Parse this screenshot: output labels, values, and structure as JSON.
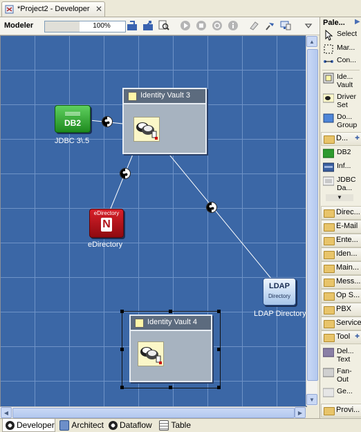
{
  "editor": {
    "tab_title": "*Project2 - Developer",
    "close_symbol": "✕"
  },
  "toolbar": {
    "modeler_label": "Modeler",
    "zoom_value": "100%"
  },
  "palette": {
    "title": "Pale...",
    "items_top": [
      {
        "label": "Select",
        "icon": "arrow-icon"
      },
      {
        "label": "Mar...",
        "icon": "marquee-icon"
      },
      {
        "label": "Con...",
        "icon": "connection-icon"
      },
      {
        "label": "Ide... Vault",
        "icon": "identity-vault-icon"
      },
      {
        "label": "Driver Set",
        "icon": "driver-set-icon"
      },
      {
        "label": "Do... Group",
        "icon": "domain-group-icon"
      }
    ],
    "drawer_open": {
      "label": "D..."
    },
    "items_drawer": [
      {
        "label": "DB2",
        "icon": "db2-icon"
      },
      {
        "label": "Inf...",
        "icon": "informix-icon"
      },
      {
        "label": "JDBC Da...",
        "icon": "jdbc-icon"
      }
    ],
    "drawers": [
      "Direc...",
      "E-Mail",
      "Ente...",
      "Iden...",
      "Main...",
      "Mess...",
      "Op S...",
      "PBX",
      "Service"
    ],
    "tool_drawer": {
      "label": "Tool"
    },
    "tool_items": [
      {
        "label": "Del... Text",
        "icon": "delimited-text-icon"
      },
      {
        "label": "Fan-Out",
        "icon": "fan-out-icon"
      },
      {
        "label": "Ge...",
        "icon": "generic-icon"
      }
    ],
    "last_drawer": "Provi..."
  },
  "canvas": {
    "vault3": {
      "title": "Identity Vault 3"
    },
    "vault4": {
      "title": "Identity Vault 4"
    },
    "db2": {
      "badge": "DB2",
      "label": "JDBC 3\\.5"
    },
    "edirectory": {
      "badge_top": "eDirectory",
      "badge_letter": "N",
      "label": "eDirectory"
    },
    "ldap": {
      "badge_top": "LDAP",
      "badge_bottom": "Directory",
      "label": "LDAP Directory"
    }
  },
  "bottom_tabs": [
    {
      "label": "Developer",
      "icon": "developer-icon",
      "active": true
    },
    {
      "label": "Architect",
      "icon": "architect-icon",
      "active": false
    },
    {
      "label": "Dataflow",
      "icon": "dataflow-icon",
      "active": false
    },
    {
      "label": "Table",
      "icon": "table-icon",
      "active": false
    }
  ],
  "colors": {
    "canvas": "#3b67a6",
    "grid": "#6f93c7",
    "vault_header": "#5c6b7e",
    "vault_body": "#a7b3c0"
  }
}
